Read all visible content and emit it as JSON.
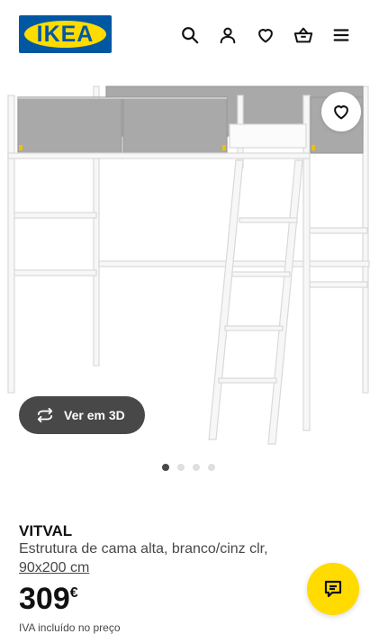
{
  "header": {
    "logo_text": "IKEA",
    "icons": [
      "search-icon",
      "user-icon",
      "heart-icon",
      "basket-icon",
      "menu-icon"
    ]
  },
  "gallery": {
    "view_3d_label": "Ver em 3D",
    "dots_count": 4,
    "active_dot": 1
  },
  "product": {
    "name": "VITVAL",
    "description": "Estrutura de cama alta, branco/cinz clr,",
    "size": "90x200 cm",
    "price": "309",
    "currency": "€",
    "vat_note": "IVA incluído no preço"
  },
  "colors": {
    "brand_blue": "#0058a3",
    "brand_yellow": "#ffdb00",
    "dark_button": "#484848"
  }
}
